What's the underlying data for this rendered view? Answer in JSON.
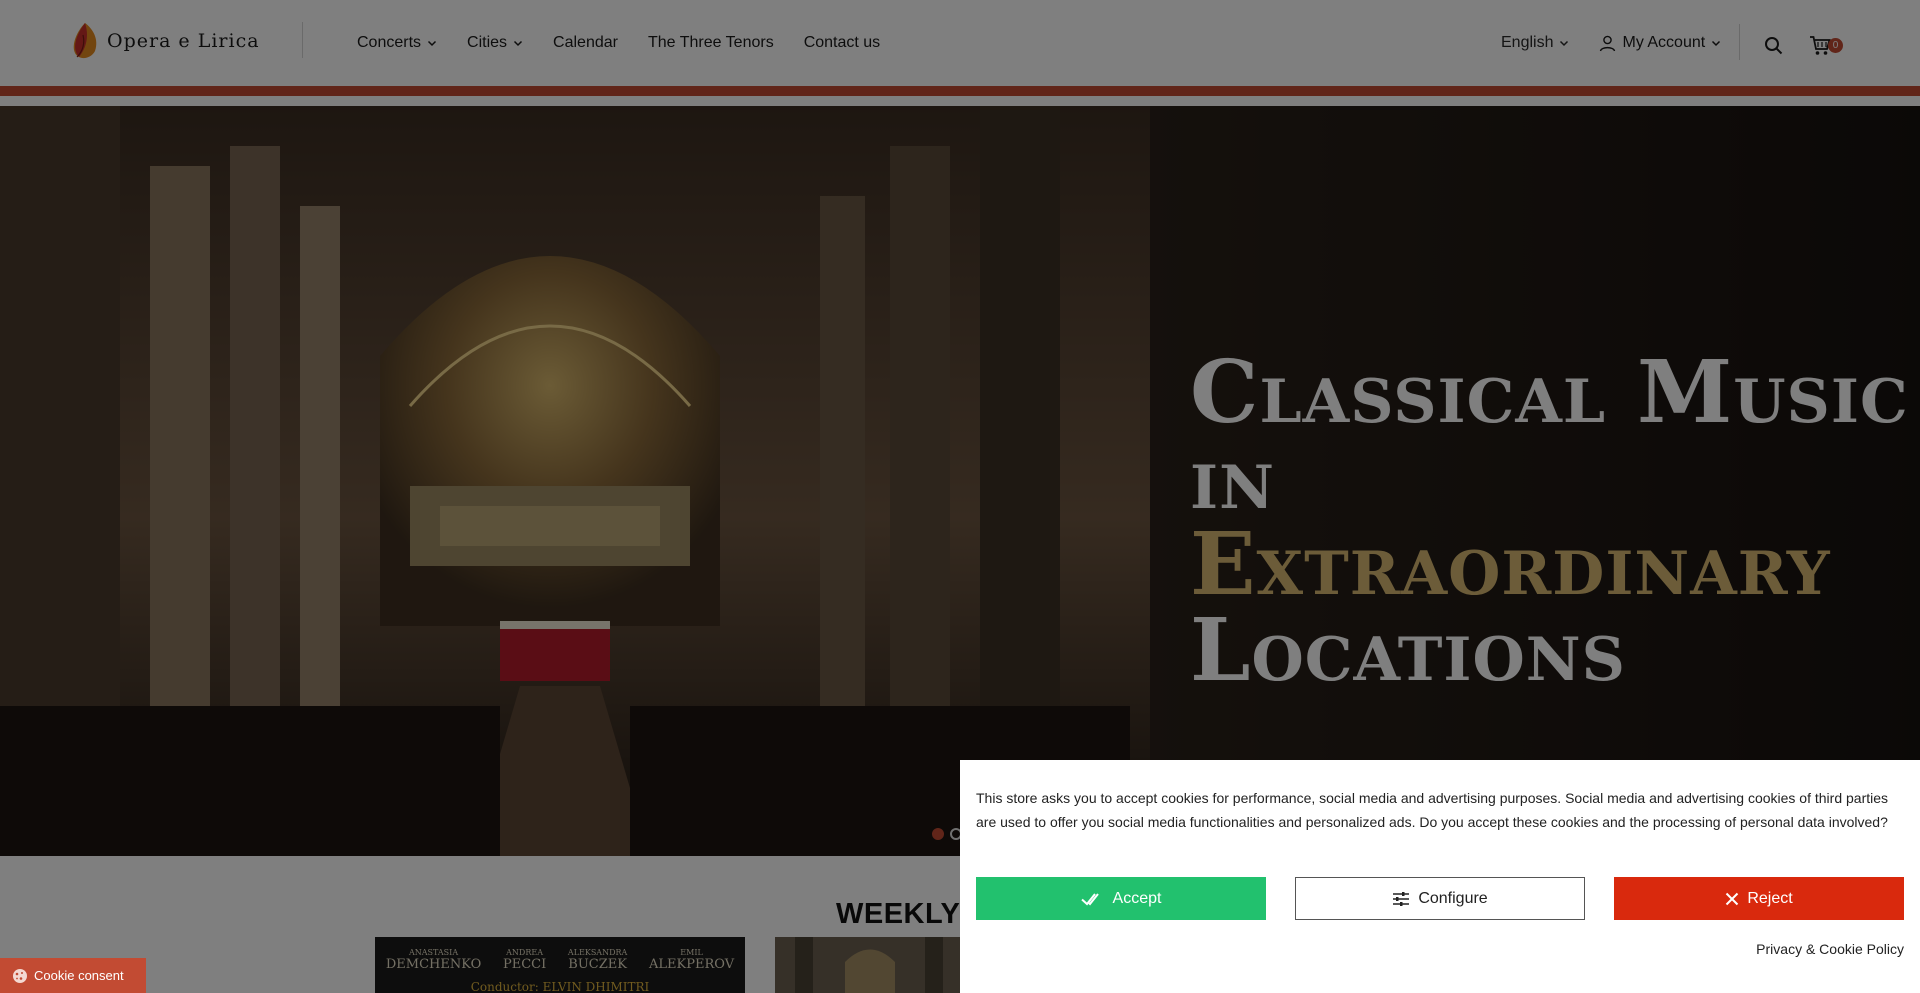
{
  "header": {
    "logo_text": "Opera e Lirica",
    "nav": [
      {
        "label": "Concerts",
        "dropdown": true
      },
      {
        "label": "Cities",
        "dropdown": true
      },
      {
        "label": "Calendar",
        "dropdown": false
      },
      {
        "label": "The Three Tenors",
        "dropdown": false
      },
      {
        "label": "Contact us",
        "dropdown": false
      }
    ],
    "language": "English",
    "account": "My Account",
    "cart_count": "0",
    "icons": {
      "search": "search-icon",
      "cart": "cart-icon",
      "user": "user-icon"
    }
  },
  "hero": {
    "title_line1": "Classical Music",
    "title_line2_prefix": "in ",
    "title_line2_accent": "Extraordinary",
    "title_line3": "Locations",
    "accent_color": "#d8b972",
    "active_slide": 1
  },
  "main": {
    "weekly_heading": "WEEKLY",
    "poster": {
      "artists": [
        {
          "first": "ANASTASIA",
          "last": "DEMCHENKO"
        },
        {
          "first": "ANDREA",
          "last": "PECCI"
        },
        {
          "first": "ALEKSANDRA",
          "last": "BUCZEK"
        },
        {
          "first": "EMIL",
          "last": "ALEKPEROV"
        }
      ],
      "conductor": "Conductor: ELVIN DHIMITRI"
    }
  },
  "cookie": {
    "tab_label": "Cookie consent",
    "message": "This store asks you to accept cookies for performance, social media and advertising purposes. Social media and advertising cookies of third parties are used to offer you social media functionalities and personalized ads. Do you accept these cookies and the processing of personal data involved?",
    "accept_label": "Accept",
    "configure_label": "Configure",
    "reject_label": "Reject",
    "privacy_label": "Privacy & Cookie Policy"
  },
  "colors": {
    "brand": "#c24b33",
    "accept": "#22c16e",
    "reject": "#d9290d"
  }
}
